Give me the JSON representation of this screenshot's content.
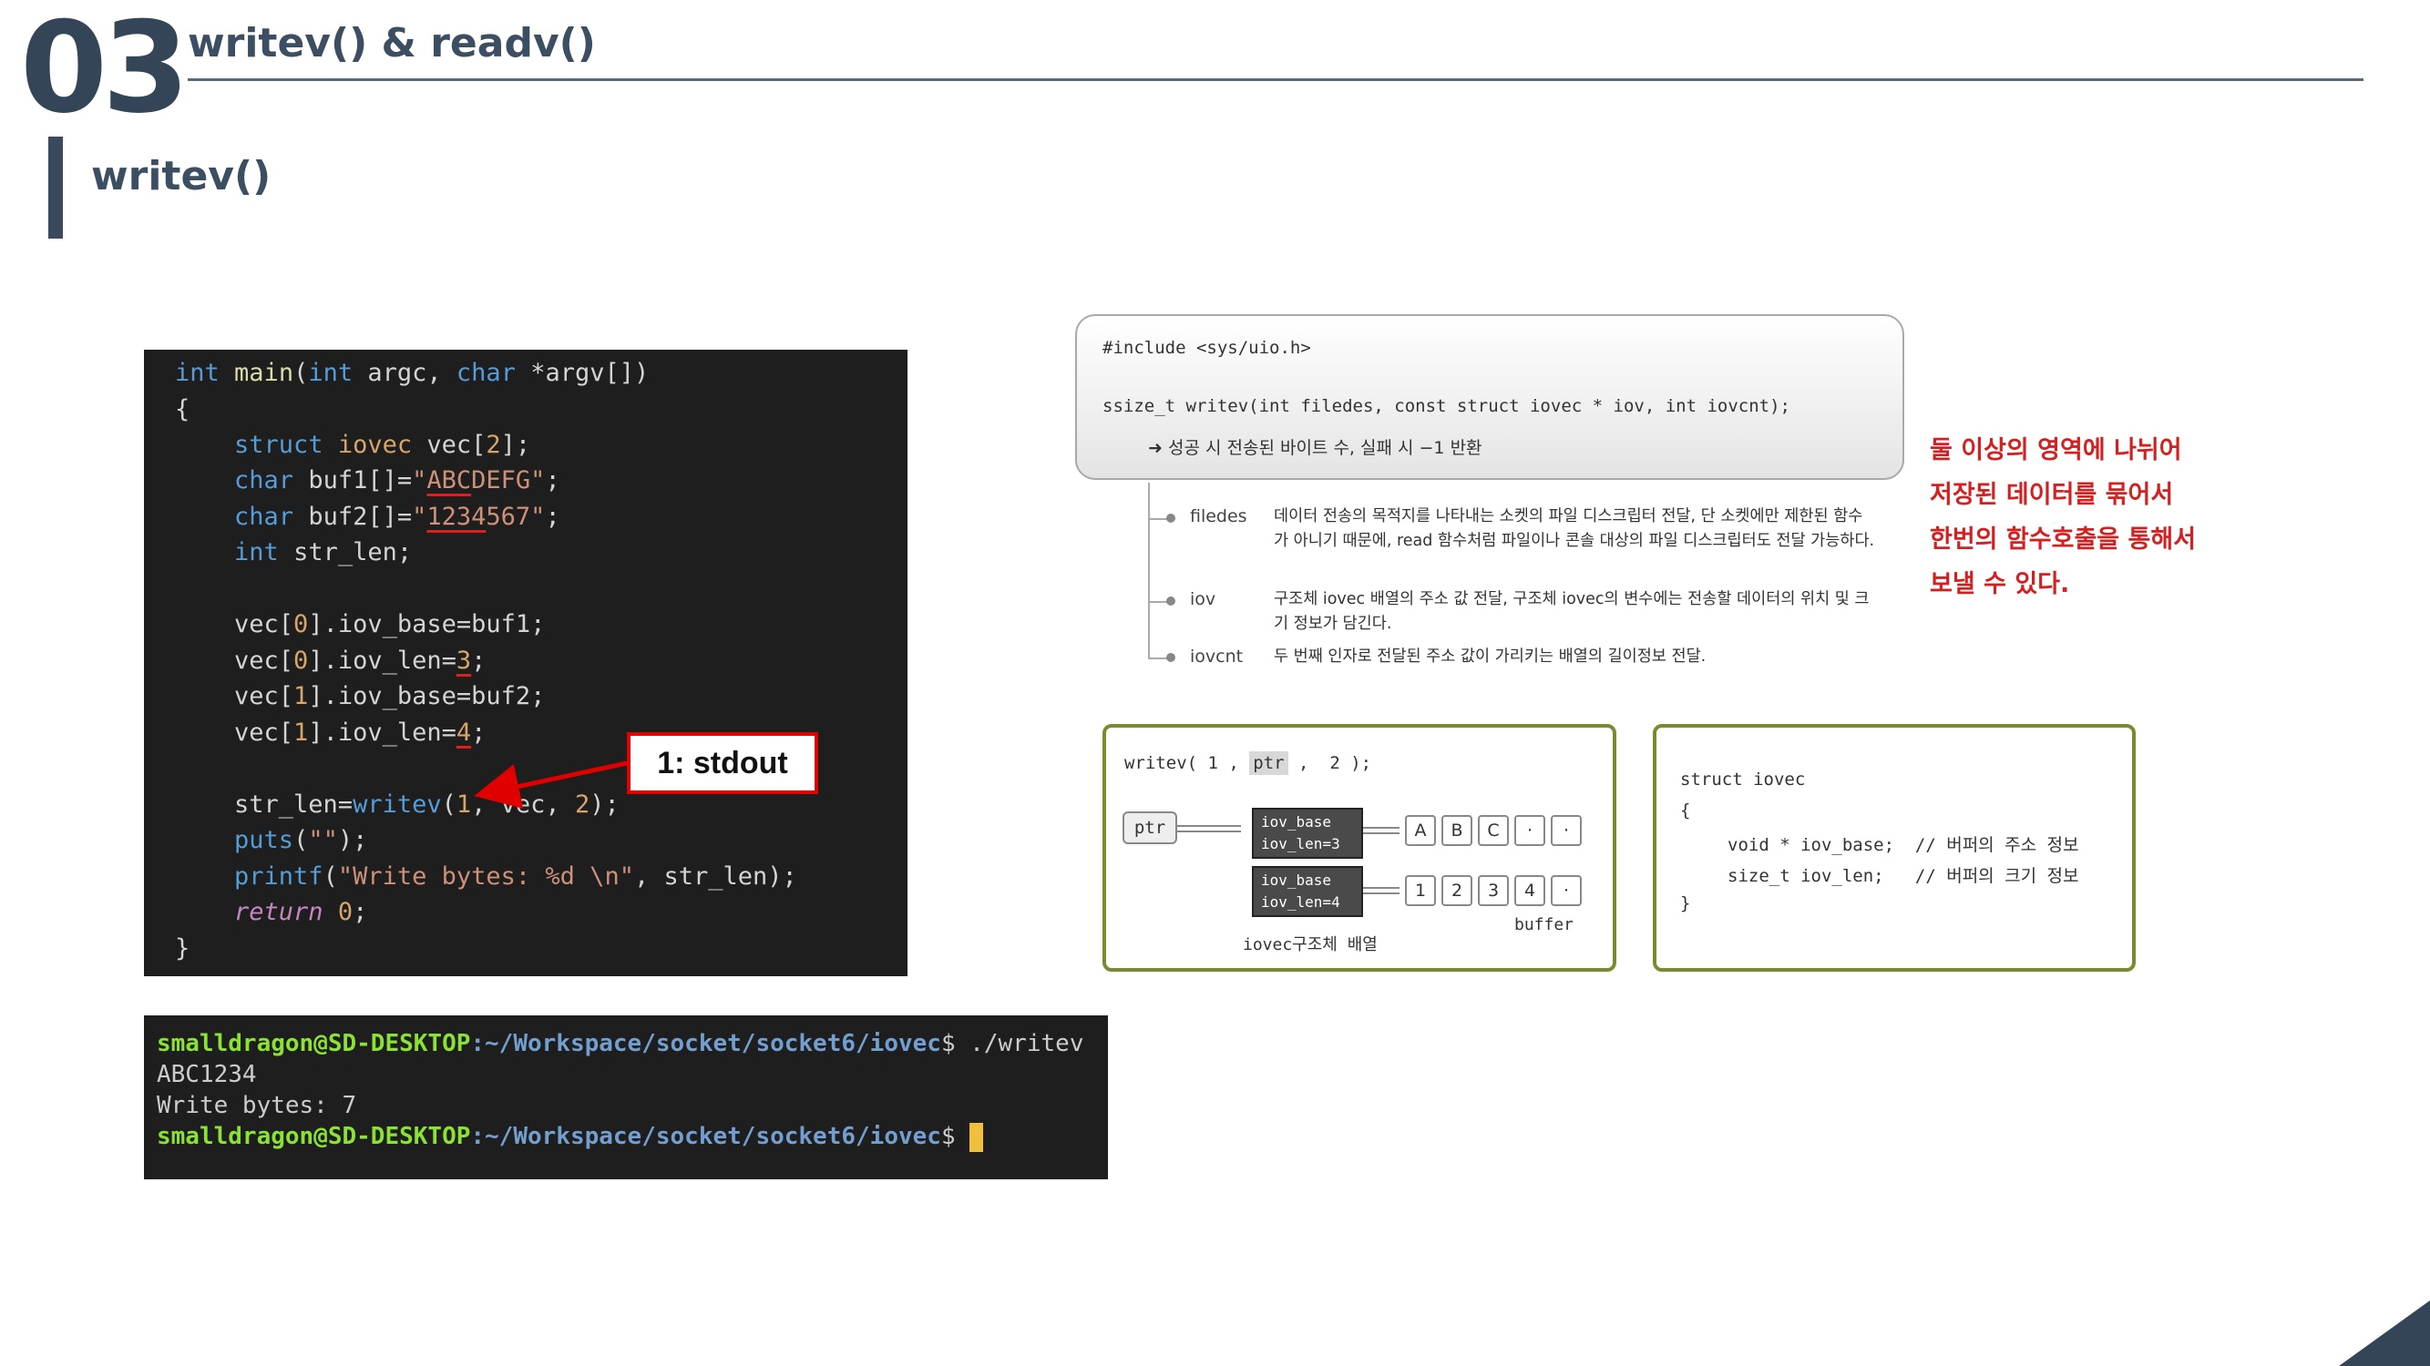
{
  "header": {
    "section_number": "03",
    "title": "writev() & readv()",
    "subtitle": "writev()"
  },
  "code": {
    "lines": [
      "int main(int argc, char *argv[])",
      "{",
      "struct iovec vec[2];",
      "char buf1[]=\"ABCDEFG\";",
      "char buf2[]=\"1234567\";",
      "int str_len;",
      "vec[0].iov_base=buf1;",
      "vec[0].iov_len=3;",
      "vec[1].iov_base=buf2;",
      "vec[1].iov_len=4;",
      "str_len=writev(1, vec, 2);",
      "puts(\"\");",
      "printf(\"Write bytes: %d \\n\", str_len);",
      "return 0;",
      "}"
    ],
    "callout": "1: stdout"
  },
  "terminal": {
    "user_host": "smalldragon@SD-DESKTOP",
    "path": ":~/Workspace/socket/socket6/iovec",
    "command": "$ ./writev",
    "output_1": "ABC1234",
    "output_2": "Write bytes: 7",
    "prompt_end": "$ "
  },
  "signature": {
    "include": "#include <sys/uio.h>",
    "prototype": "ssize_t writev(int filedes, const struct iovec * iov, int iovcnt);",
    "return_desc": "➜ 성공 시 전송된 바이트 수, 실패 시 −1 반환"
  },
  "params": [
    {
      "name": "filedes",
      "desc": "데이터 전송의 목적지를 나타내는 소켓의 파일 디스크립터 전달, 단 소켓에만 제한된 함수가 아니기 때문에, read 함수처럼 파일이나 콘솔 대상의 파일 디스크립터도 전달 가능하다."
    },
    {
      "name": "iov",
      "desc": "구조체 iovec 배열의 주소 값 전달, 구조체 iovec의 변수에는 전송할 데이터의 위치 및 크기 정보가 담긴다."
    },
    {
      "name": "iovcnt",
      "desc": "두 번째 인자로 전달된 주소 값이 가리키는 배열의 길이정보 전달."
    }
  ],
  "note": {
    "lines": [
      "둘 이상의 영역에 나뉘어",
      "저장된 데이터를 묶어서",
      "한번의 함수호출을 통해서",
      "보낼 수 있다."
    ]
  },
  "diagram": {
    "call_prefix": "writev( 1 , ",
    "call_ptr": "ptr",
    "call_suffix": " ,  2 );",
    "ptr_label": "ptr",
    "iov1_base": "iov_base",
    "iov1_len": "iov_len=3",
    "iov2_base": "iov_base",
    "iov2_len": "iov_len=4",
    "buf1_cells": [
      "A",
      "B",
      "C",
      "·",
      "·"
    ],
    "buf2_cells": [
      "1",
      "2",
      "3",
      "4",
      "·"
    ],
    "array_caption": "iovec구조체 배열",
    "buffer_caption": "buffer"
  },
  "struct_def": {
    "line1": "struct iovec",
    "line2": "{",
    "line3": "void * iov_base;  // 버퍼의 주소 정보",
    "line4": "size_t iov_len;   // 버퍼의 크기 정보",
    "line5": "}"
  },
  "colors": {
    "header": "#344558",
    "code_bg": "#1e1e1e",
    "callout_red": "#e00000",
    "note_red": "#d42020",
    "diagram_border": "#7b8a2c"
  }
}
